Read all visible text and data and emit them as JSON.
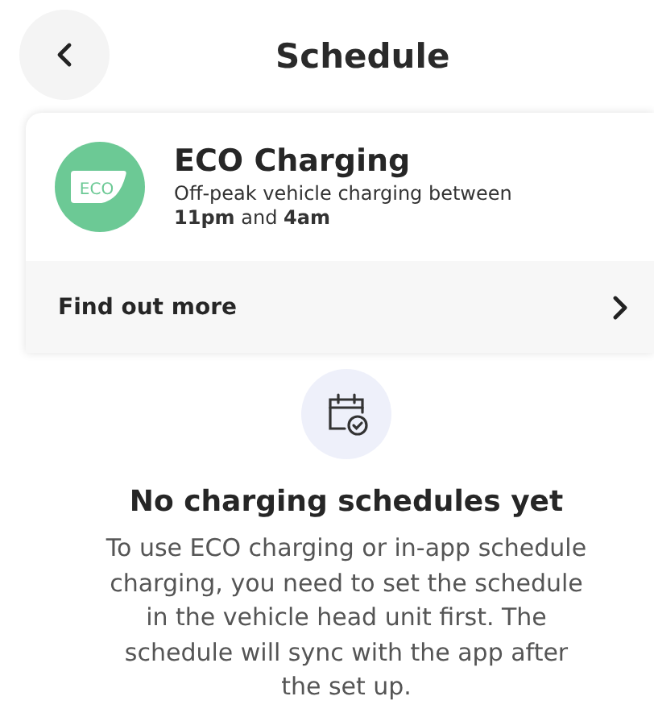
{
  "header": {
    "title": "Schedule"
  },
  "eco_card": {
    "badge": "ECO",
    "title": "ECO Charging",
    "subtitle": "Off-peak vehicle charging between **11pm** and **4am**",
    "link": "Find out more"
  },
  "empty_state": {
    "heading": "No charging schedules yet",
    "message": "To use ECO charging or in-app schedule charging, you need to set the schedule in the vehicle head unit first. The schedule will sync with the app after the set up."
  }
}
